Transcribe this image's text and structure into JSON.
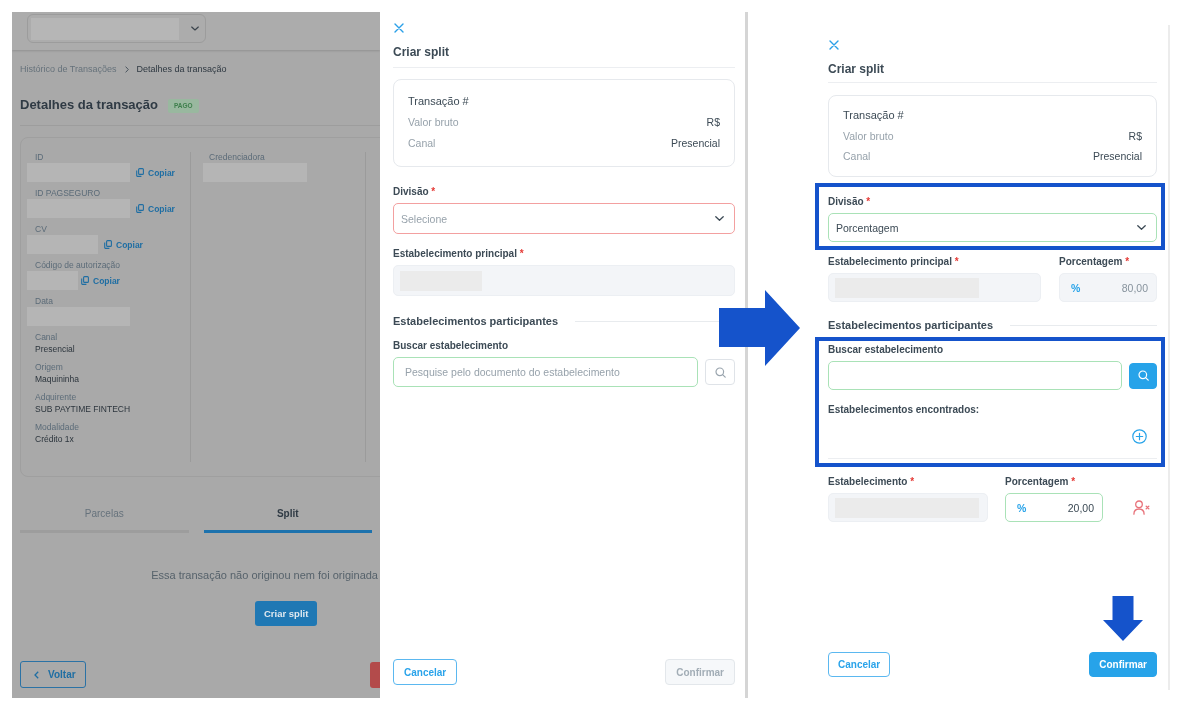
{
  "left_screen": {
    "background_page": {
      "account_selector": {
        "redacted": true
      },
      "breadcrumb": [
        {
          "label": "Histórico de Transações",
          "current": false
        },
        {
          "label": "Detalhes da transação",
          "current": true
        }
      ],
      "title": "Detalhes da transação",
      "status_badge": "PAGO",
      "detail_columns": [
        {
          "fields": [
            {
              "label": "ID",
              "redacted": true,
              "action": "Copiar"
            },
            {
              "label": "ID PAGSEGURO",
              "redacted": true,
              "action": "Copiar"
            },
            {
              "label": "CV",
              "redacted": true,
              "action": "Copiar"
            },
            {
              "label": "Código de autorização",
              "redacted": true,
              "action": "Copiar"
            },
            {
              "label": "Data",
              "redacted": true
            },
            {
              "label": "Canal",
              "value": "Presencial"
            },
            {
              "label": "Origem",
              "value": "Maquininha"
            },
            {
              "label": "Adquirente",
              "value": "SUB PAYTIME FINTECH"
            },
            {
              "label": "Modalidade",
              "value": "Crédito 1x"
            }
          ]
        },
        {
          "fields": [
            {
              "label": "Credenciadora",
              "redacted": true
            }
          ]
        }
      ],
      "tabs": [
        {
          "label": "Parcelas",
          "selected": false
        },
        {
          "label": "Split",
          "selected": true
        }
      ],
      "empty_message": "Essa transação não originou nem foi originada",
      "create_button": "Criar split",
      "footer_buttons": [
        {
          "kind": "back",
          "label": "Voltar"
        },
        {
          "kind": "danger"
        }
      ]
    },
    "drawer": {
      "title": "Criar split",
      "summary": {
        "heading": "Transação #",
        "rows": [
          {
            "label": "Valor bruto",
            "value": "R$"
          },
          {
            "label": "Canal",
            "value": "Presencial"
          }
        ]
      },
      "division": {
        "label": "Divisão",
        "required_mark": "*",
        "placeholder": "Selecione",
        "invalid": true
      },
      "main_establishment": {
        "label": "Estabelecimento principal",
        "required_mark": "*",
        "redacted": true,
        "disabled": true
      },
      "participants_heading": "Estabelecimentos participantes",
      "search": {
        "label": "Buscar estabelecimento",
        "placeholder": "Pesquise pelo documento do estabelecimento",
        "valid": true,
        "button_filled": false
      },
      "buttons": [
        {
          "label": "Cancelar",
          "kind": "secondary",
          "disabled": false
        },
        {
          "label": "Confirmar",
          "kind": "primary",
          "disabled": true
        }
      ]
    }
  },
  "right_screen": {
    "drawer": {
      "title": "Criar split",
      "summary": {
        "heading": "Transação #",
        "rows": [
          {
            "label": "Valor bruto",
            "value": "R$"
          },
          {
            "label": "Canal",
            "value": "Presencial"
          }
        ]
      },
      "division": {
        "label": "Divisão",
        "required_mark": "*",
        "value": "Porcentagem",
        "valid": true,
        "highlighted": true
      },
      "main_establishment": {
        "label": "Estabelecimento principal",
        "required_mark": "*",
        "redacted": true,
        "disabled": true
      },
      "main_percentage": {
        "label": "Porcentagem",
        "required_mark": "*",
        "prefix": "%",
        "value": "80,00",
        "disabled": true
      },
      "participants_heading": "Estabelecimentos participantes",
      "search": {
        "label": "Buscar estabelecimento",
        "valid": true,
        "button_filled": true,
        "highlighted": true,
        "results_heading": "Estabelecimentos encontrados:"
      },
      "participants": [
        {
          "establishment": {
            "label": "Estabelecimento",
            "required_mark": "*",
            "redacted": true,
            "disabled": true
          },
          "percentage": {
            "label": "Porcentagem",
            "required_mark": "*",
            "prefix": "%",
            "value": "20,00",
            "valid": true
          }
        }
      ],
      "buttons": [
        {
          "label": "Cancelar",
          "kind": "secondary",
          "disabled": false
        },
        {
          "label": "Confirmar",
          "kind": "primary",
          "disabled": false,
          "highlighted": true
        }
      ]
    }
  }
}
